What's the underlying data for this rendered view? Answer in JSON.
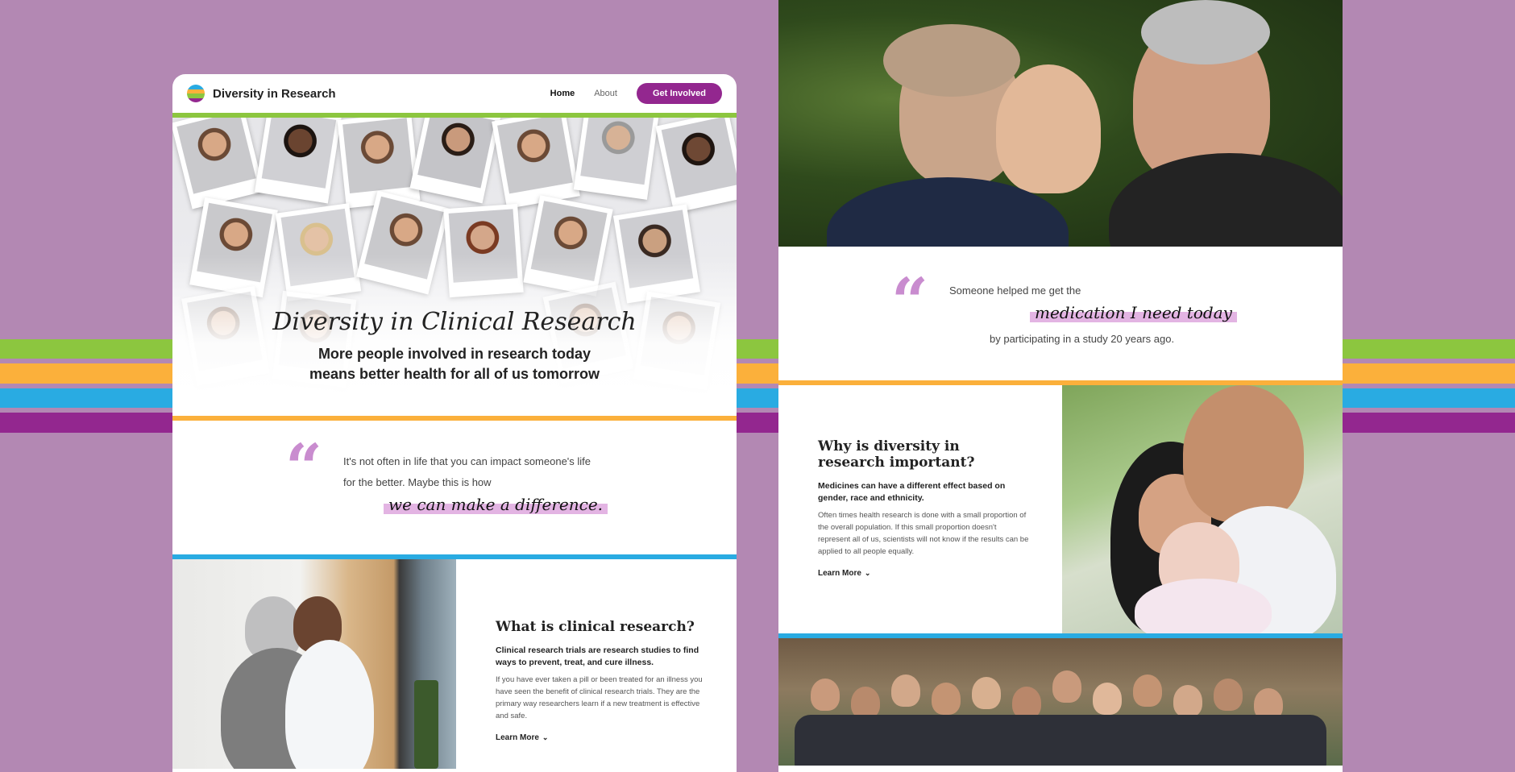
{
  "colors": {
    "background": "#b388b3",
    "green": "#8cc63f",
    "orange": "#fbb03b",
    "blue": "#29abe2",
    "purple": "#93278f",
    "highlight": "#e3b4e3"
  },
  "nav": {
    "brand": "Diversity in Research",
    "links": [
      "Home",
      "About"
    ],
    "cta": "Get Involved",
    "logo_icon": "striped-circle-icon"
  },
  "hero": {
    "title": "Diversity in Clinical Research",
    "subtitle_line1": "More people involved in research today",
    "subtitle_line2": "means better health for all of us tomorrow"
  },
  "quote_left": {
    "mark": "“",
    "line1": "It's not often in life that you can impact someone's life",
    "line2": "for the better. Maybe this is how",
    "highlight": "we can make a difference."
  },
  "clinical": {
    "title": "What is clinical research?",
    "lead": "Clinical research trials are research studies to find ways to prevent, treat, and cure illness.",
    "body": "If you have ever taken a pill or been treated for an illness you have seen the benefit of clinical research trials. They are the primary way researchers learn if a new treatment is effective and safe.",
    "link": "Learn More"
  },
  "quote_right": {
    "mark": "“",
    "line1": "Someone helped me get the",
    "highlight": "medication I need today",
    "line2": "by participating in a study 20 years ago."
  },
  "why": {
    "title": "Why is diversity in research important?",
    "lead": "Medicines can have a different effect based on gender, race and ethnicity.",
    "body": "Often times health research is done with a small proportion of the overall population. If this small proportion doesn't represent all of us, scientists will not know if the results can be applied to all people equally.",
    "link": "Learn More"
  }
}
